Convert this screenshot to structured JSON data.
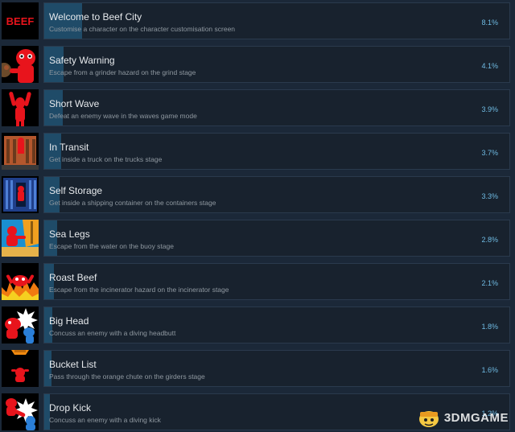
{
  "achievements": [
    {
      "title": "Welcome to Beef City",
      "description": "Customise a character on the character customisation screen",
      "percent": "8.1%",
      "icon": "beef-logo-icon",
      "progress_fraction": 0.081
    },
    {
      "title": "Safety Warning",
      "description": "Escape from a grinder hazard on the grind stage",
      "percent": "4.1%",
      "icon": "grinder-character-icon",
      "progress_fraction": 0.041
    },
    {
      "title": "Short Wave",
      "description": "Defeat an enemy wave in the waves game mode",
      "percent": "3.9%",
      "icon": "waving-character-icon",
      "progress_fraction": 0.039
    },
    {
      "title": "In Transit",
      "description": "Get inside a truck on the trucks stage",
      "percent": "3.7%",
      "icon": "truck-icon",
      "progress_fraction": 0.037
    },
    {
      "title": "Self Storage",
      "description": "Get inside a shipping container on the containers stage",
      "percent": "3.3%",
      "icon": "shipping-container-icon",
      "progress_fraction": 0.033
    },
    {
      "title": "Sea Legs",
      "description": "Escape from the water on the buoy stage",
      "percent": "2.8%",
      "icon": "buoy-icon",
      "progress_fraction": 0.028
    },
    {
      "title": "Roast Beef",
      "description": "Escape from the incinerator hazard on the incinerator stage",
      "percent": "2.1%",
      "icon": "fire-icon",
      "progress_fraction": 0.021
    },
    {
      "title": "Big Head",
      "description": "Concuss an enemy with a diving headbutt",
      "percent": "1.8%",
      "icon": "headbutt-icon",
      "progress_fraction": 0.018
    },
    {
      "title": "Bucket List",
      "description": "Pass through the orange chute on the girders stage",
      "percent": "1.6%",
      "icon": "chute-icon",
      "progress_fraction": 0.016
    },
    {
      "title": "Drop Kick",
      "description": "Concuss an enemy with a diving kick",
      "percent": "1.2%",
      "icon": "drop-kick-icon",
      "progress_fraction": 0.012
    }
  ],
  "icon_text": {
    "beef_logo": "BEEF"
  },
  "watermark": {
    "text": "3DMGAME",
    "icon": "3dm-mascot-icon"
  },
  "colors": {
    "background": "#1b2838",
    "card": "#18222e",
    "progress": "#1f4b68",
    "title": "#e6e9ec",
    "description": "#8f98a0",
    "percent": "#6fbbe3",
    "character_red": "#e8141c"
  }
}
